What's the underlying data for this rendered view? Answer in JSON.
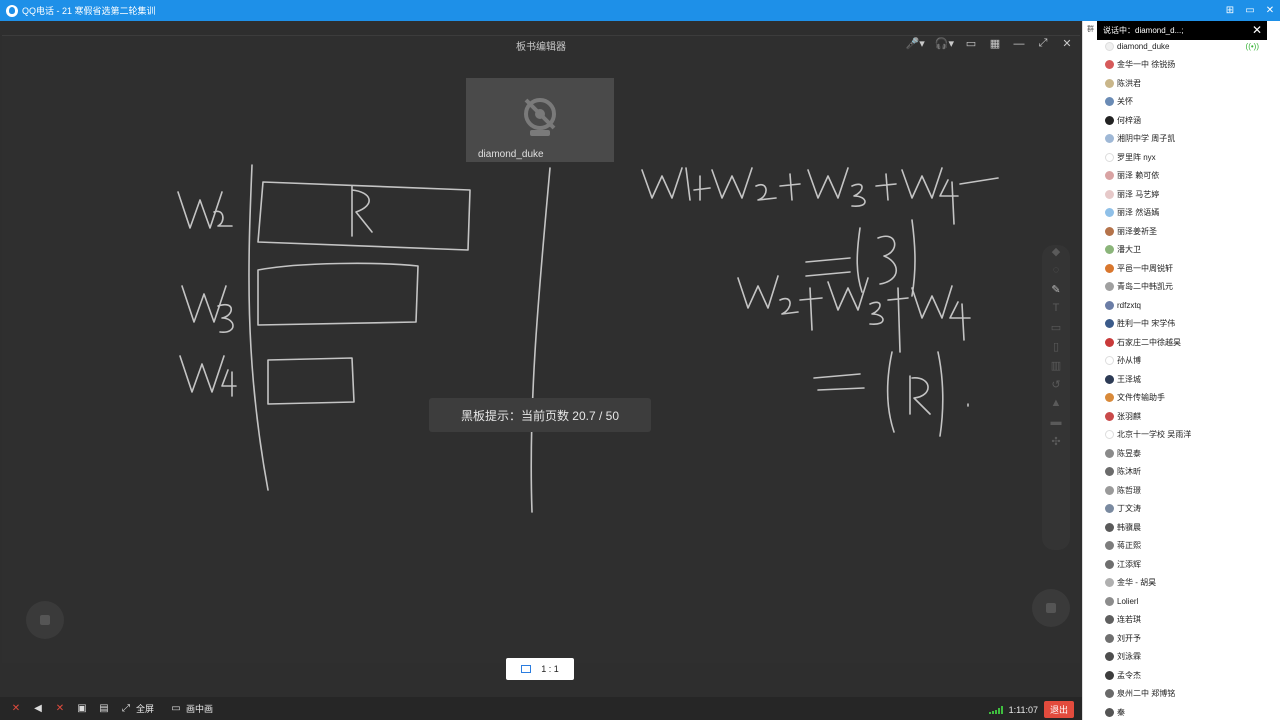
{
  "app": {
    "window_title": "QQ电话 - 21 寒假省选第二轮集训",
    "window_controls": [
      "⊞",
      "▭",
      "✕"
    ]
  },
  "board": {
    "title": "板书编辑器",
    "tools": [
      "🎤▾",
      "🎧▾",
      "▭",
      "▦",
      "—",
      "⤢",
      "✕"
    ]
  },
  "camera": {
    "name": "diamond_duke"
  },
  "toast": {
    "text": "黑板提示：当前页数 20.7 / 50"
  },
  "ratio": {
    "label": "1 : 1"
  },
  "bottom_bar": {
    "items": [
      {
        "icon": "mic-off-icon",
        "glyph": "✕",
        "label": ""
      },
      {
        "icon": "speaker-icon",
        "glyph": "◀",
        "label": ""
      },
      {
        "icon": "camera-off-icon",
        "glyph": "✕",
        "label": ""
      },
      {
        "icon": "share-screen-icon",
        "glyph": "▣",
        "label": ""
      },
      {
        "icon": "board-icon",
        "glyph": "▤",
        "label": ""
      },
      {
        "icon": "fullscreen-icon",
        "glyph": "⤢",
        "label": "全屏"
      },
      {
        "icon": "pip-icon",
        "glyph": "▭",
        "label": "画中画"
      }
    ],
    "duration": "1:11:07",
    "exit_label": "退出"
  },
  "panel": {
    "speaking_label": "说话中：diamond_d...;",
    "edge_glyph": "群",
    "members": [
      {
        "name": "diamond_duke",
        "color": "#f0f0f0",
        "speaking": true
      },
      {
        "name": "金华一中 徐锐扬",
        "color": "#d65a5a"
      },
      {
        "name": "陈洪君",
        "color": "#c9b68a"
      },
      {
        "name": "关怀",
        "color": "#6a8bb5"
      },
      {
        "name": "何梓涵",
        "color": "#222222"
      },
      {
        "name": "湘阴中学 周子凯",
        "color": "#9fb8d6"
      },
      {
        "name": "罗里阵 nyx",
        "color": "#ffffff"
      },
      {
        "name": "丽泽 赖可依",
        "color": "#d9a3a3"
      },
      {
        "name": "丽泽 马艺婷",
        "color": "#e6c9c9"
      },
      {
        "name": "丽泽 然语嫣",
        "color": "#8fc0e8"
      },
      {
        "name": "丽泽姜祈圣",
        "color": "#b5734a"
      },
      {
        "name": "潘大卫",
        "color": "#8bb57a"
      },
      {
        "name": "平邑一中周锐轩",
        "color": "#d9772e"
      },
      {
        "name": "青岛二中韩凯元",
        "color": "#a0a0a0"
      },
      {
        "name": "rdfzxtq",
        "color": "#6b7da6"
      },
      {
        "name": "胜利一中 宋学伟",
        "color": "#3b5b8a"
      },
      {
        "name": "石家庄二中徐越昊",
        "color": "#c93a3a"
      },
      {
        "name": "孙从博",
        "color": "#ffffff"
      },
      {
        "name": "王泽城",
        "color": "#2d3b55"
      },
      {
        "name": "文件传输助手",
        "color": "#d98a3a"
      },
      {
        "name": "张羽麒",
        "color": "#c94a4a"
      },
      {
        "name": "北京十一学校 吴雨洋",
        "color": "#ffffff"
      },
      {
        "name": "陈昱泰",
        "color": "#8a8a8a"
      },
      {
        "name": "陈沐昕",
        "color": "#6b6b6b"
      },
      {
        "name": "陈哲璟",
        "color": "#9a9a9a"
      },
      {
        "name": "丁文涛",
        "color": "#7a8aa0"
      },
      {
        "name": "韩骥晨",
        "color": "#5a5a5a"
      },
      {
        "name": "蒋正熙",
        "color": "#7d7d7d"
      },
      {
        "name": "江添辉",
        "color": "#6e6e6e"
      },
      {
        "name": "金华 - 胡昊",
        "color": "#b0b0b0"
      },
      {
        "name": "Lolierl",
        "color": "#8c8c8c"
      },
      {
        "name": "连若琪",
        "color": "#5f5f5f"
      },
      {
        "name": "刘开予",
        "color": "#707070"
      },
      {
        "name": "刘泳霖",
        "color": "#4e4e4e"
      },
      {
        "name": "孟令杰",
        "color": "#3d3d3d"
      },
      {
        "name": "泉州二中 郑博铭",
        "color": "#6a6a6a"
      },
      {
        "name": "秦",
        "color": "#555555"
      }
    ]
  }
}
